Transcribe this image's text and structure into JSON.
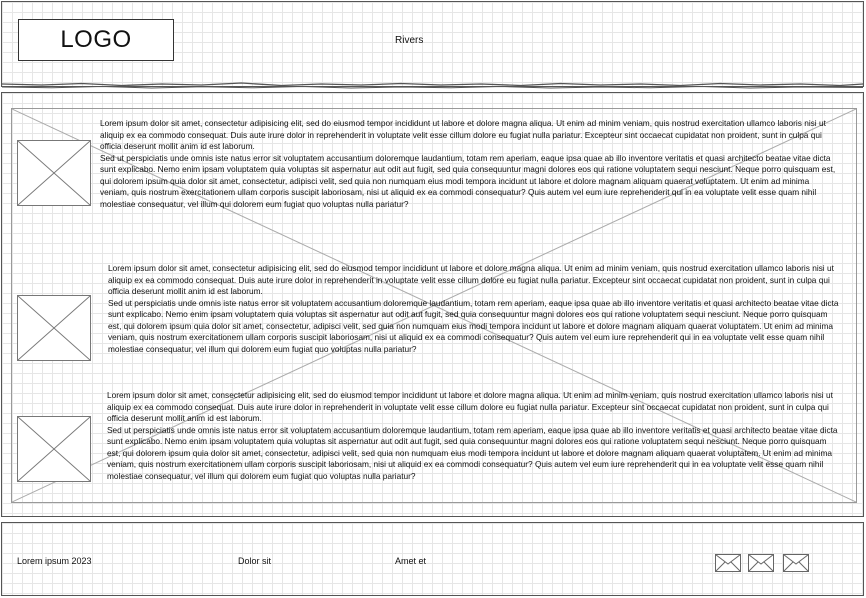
{
  "header": {
    "logo_text": "LOGO",
    "site_title": "Rivers"
  },
  "sections": [
    {
      "image_icon": "image-placeholder-icon",
      "para1": "Lorem ipsum dolor sit amet, consectetur adipisicing elit, sed do eiusmod tempor incididunt ut labore et dolore magna aliqua. Ut enim ad minim veniam, quis nostrud exercitation ullamco laboris nisi ut aliquip ex ea commodo consequat. Duis aute irure dolor in reprehenderit in voluptate velit esse cillum dolore eu fugiat nulla pariatur. Excepteur sint occaecat cupidatat non proident, sunt in culpa qui officia deserunt mollit anim id est laborum.",
      "para2": "Sed ut perspiciatis unde omnis iste natus error sit voluptatem accusantium doloremque laudantium, totam rem aperiam, eaque ipsa quae ab illo inventore veritatis et quasi architecto beatae vitae dicta sunt explicabo. Nemo enim ipsam voluptatem quia voluptas sit aspernatur aut odit aut fugit, sed quia consequuntur magni dolores eos qui ratione voluptatem sequi nesciunt. Neque porro quisquam est, qui dolorem ipsum quia dolor sit amet, consectetur, adipisci velit, sed quia non numquam eius modi tempora incidunt ut labore et dolore magnam aliquam quaerat voluptatem. Ut enim ad minima veniam, quis nostrum exercitationem ullam corporis suscipit laboriosam, nisi ut aliquid ex ea commodi consequatur? Quis autem vel eum iure reprehenderit qui in ea voluptate velit esse quam nihil molestiae consequatur, vel illum qui dolorem eum fugiat quo voluptas nulla pariatur?"
    },
    {
      "image_icon": "image-placeholder-icon",
      "para1": "Lorem ipsum dolor sit amet, consectetur adipisicing elit, sed do eiusmod tempor incididunt ut labore et dolore magna aliqua. Ut enim ad minim veniam, quis nostrud exercitation ullamco laboris nisi ut aliquip ex ea commodo consequat. Duis aute irure dolor in reprehenderit in voluptate velit esse cillum dolore eu fugiat nulla pariatur. Excepteur sint occaecat cupidatat non proident, sunt in culpa qui officia deserunt mollit anim id est laborum.",
      "para2": "Sed ut perspiciatis unde omnis iste natus error sit voluptatem accusantium doloremque laudantium, totam rem aperiam, eaque ipsa quae ab illo inventore veritatis et quasi architecto beatae vitae dicta sunt explicabo. Nemo enim ipsam voluptatem quia voluptas sit aspernatur aut odit aut fugit, sed quia consequuntur magni dolores eos qui ratione voluptatem sequi nesciunt. Neque porro quisquam est, qui dolorem ipsum quia dolor sit amet, consectetur, adipisci velit, sed quia non numquam eius modi tempora incidunt ut labore et dolore magnam aliquam quaerat voluptatem. Ut enim ad minima veniam, quis nostrum exercitationem ullam corporis suscipit laboriosam, nisi ut aliquid ex ea commodi consequatur? Quis autem vel eum iure reprehenderit qui in ea voluptate velit esse quam nihil molestiae consequatur, vel illum qui dolorem eum fugiat quo voluptas nulla pariatur?"
    },
    {
      "image_icon": "image-placeholder-icon",
      "para1": "Lorem ipsum dolor sit amet, consectetur adipisicing elit, sed do eiusmod tempor incididunt ut labore et dolore magna aliqua. Ut enim ad minim veniam, quis nostrud exercitation ullamco laboris nisi ut aliquip ex ea commodo consequat. Duis aute irure dolor in reprehenderit in voluptate velit esse cillum dolore eu fugiat nulla pariatur. Excepteur sint occaecat cupidatat non proident, sunt in culpa qui officia deserunt mollit anim id est laborum.",
      "para2": "Sed ut perspiciatis unde omnis iste natus error sit voluptatem accusantium doloremque laudantium, totam rem aperiam, eaque ipsa quae ab illo inventore veritatis et quasi architecto beatae vitae dicta sunt explicabo. Nemo enim ipsam voluptatem quia voluptas sit aspernatur aut odit aut fugit, sed quia consequuntur magni dolores eos qui ratione voluptatem sequi nesciunt. Neque porro quisquam est, qui dolorem ipsum quia dolor sit amet, consectetur, adipisci velit, sed quia non numquam eius modi tempora incidunt ut labore et dolore magnam aliquam quaerat voluptatem. Ut enim ad minima veniam, quis nostrum exercitationem ullam corporis suscipit laboriosam, nisi ut aliquid ex ea commodi consequatur? Quis autem vel eum iure reprehenderit qui in ea voluptate velit esse quam nihil molestiae consequatur, vel illum qui dolorem eum fugiat quo voluptas nulla pariatur?"
    }
  ],
  "footer": {
    "copyright": "Lorem ipsum 2023",
    "link1": "Dolor sit",
    "link2": "Amet et",
    "icons": [
      "mail-icon",
      "mail-icon",
      "mail-icon"
    ]
  },
  "colors": {
    "border": "#555555",
    "grid": "#e6e6e6",
    "text": "#111111"
  }
}
